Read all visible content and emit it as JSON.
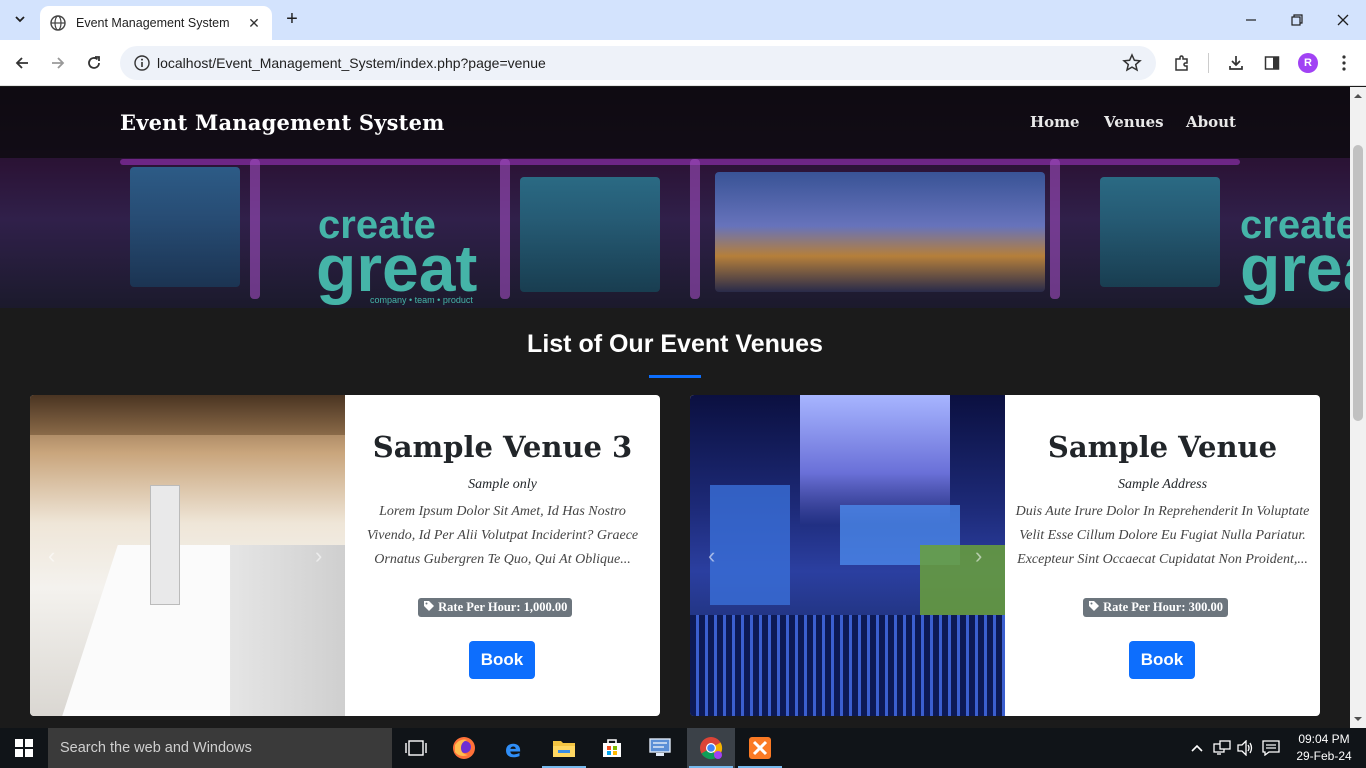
{
  "browser": {
    "tab_title": "Event Management System",
    "url": "localhost/Event_Management_System/index.php?page=venue",
    "profile_initial": "R"
  },
  "site": {
    "brand": "Event Management System",
    "nav": [
      "Home",
      "Venues",
      "About"
    ]
  },
  "hero": {
    "banner_words": [
      "create",
      "great",
      "company • team • product"
    ]
  },
  "section": {
    "title": "List of Our Event Venues"
  },
  "venues": [
    {
      "name": "Sample Venue 3",
      "address": "Sample only",
      "description": "Lorem Ipsum Dolor Sit Amet, Id Has Nostro Vivendo, Id Per Alii Volutpat Inciderint? Graece Ornatus Gubergren Te Quo, Qui At Oblique...",
      "rate": "Rate Per Hour: 1,000.00",
      "book_label": "Book"
    },
    {
      "name": "Sample Venue",
      "address": "Sample Address",
      "description": "Duis Aute Irure Dolor In Reprehenderit In Voluptate Velit Esse Cillum Dolore Eu Fugiat Nulla Pariatur. Excepteur Sint Occaecat Cupidatat Non Proident,...",
      "rate": "Rate Per Hour: 300.00",
      "book_label": "Book"
    }
  ],
  "taskbar": {
    "search_placeholder": "Search the web and Windows",
    "time": "09:04 PM",
    "date": "29-Feb-24"
  },
  "colors": {
    "accent": "#0d6efd",
    "page_bg": "#1b1b1b",
    "badge": "#6c757d"
  }
}
